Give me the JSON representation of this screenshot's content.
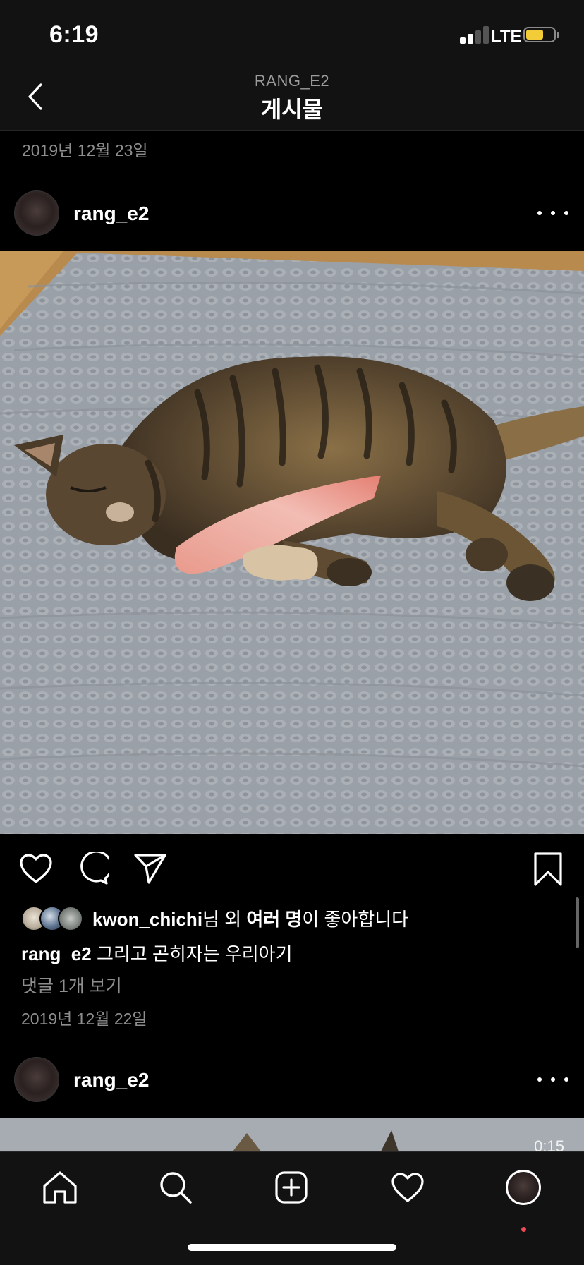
{
  "status_bar": {
    "time": "6:19",
    "network": "LTE",
    "battery_color": "#f2cd37"
  },
  "header": {
    "username": "RANG_E2",
    "title": "게시물"
  },
  "previous_post_date": "2019년 12월 23일",
  "post": {
    "username": "rang_e2",
    "likes": {
      "user": "kwon_chichi",
      "suffix": "님 외 ",
      "others": "여러 명",
      "end": "이 좋아합니다"
    },
    "caption": {
      "user": "rang_e2",
      "text": " 그리고 곤히자는 우리아기"
    },
    "view_comments": "댓글 1개 보기",
    "date": "2019년 12월 22일"
  },
  "next_post": {
    "username": "rang_e2",
    "video_time": "0:15"
  },
  "tab_bar": {
    "items": [
      "home-icon",
      "search-icon",
      "new-post-icon",
      "activity-heart-icon",
      "profile-avatar"
    ],
    "notification_dot_color": "#ed4956"
  }
}
